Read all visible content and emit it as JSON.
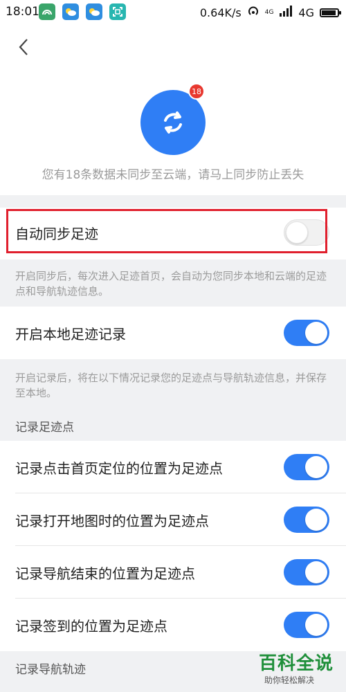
{
  "status_bar": {
    "time": "18:01",
    "network_speed": "0.64K/s",
    "network_type_small": "4G",
    "network_type": "4G",
    "battery_level": 0.9,
    "apps": [
      "wifi-app-icon",
      "weather-app-icon",
      "weather-app-icon",
      "scan-app-icon"
    ]
  },
  "header": {
    "back_icon": "chevron-left-icon",
    "sync_icon": "sync-arrows-icon",
    "badge_count": "18",
    "hint": "您有18条数据未同步至云端，请马上同步防止丢失"
  },
  "colors": {
    "accent": "#2f7ef5",
    "badge": "#e8382f",
    "highlight": "#e01f2d",
    "watermark": "#1f8f3a"
  },
  "auto_sync": {
    "label": "自动同步足迹",
    "enabled": false,
    "description": "开启同步后，每次进入足迹首页，会自动为您同步本地和云端的足迹点和导航轨迹信息。"
  },
  "local_record": {
    "label": "开启本地足迹记录",
    "enabled": true,
    "description": "开启记录后，将在以下情况记录您的足迹点与导航轨迹信息，并保存至本地。"
  },
  "footprint_section": {
    "title": "记录足迹点",
    "items": [
      {
        "label": "记录点击首页定位的位置为足迹点",
        "enabled": true
      },
      {
        "label": "记录打开地图时的位置为足迹点",
        "enabled": true
      },
      {
        "label": "记录导航结束的位置为足迹点",
        "enabled": true
      },
      {
        "label": "记录签到的位置为足迹点",
        "enabled": true
      }
    ]
  },
  "track_section": {
    "title": "记录导航轨迹"
  },
  "watermark": {
    "title": "百科全说",
    "subtitle": "助你轻松解决"
  }
}
